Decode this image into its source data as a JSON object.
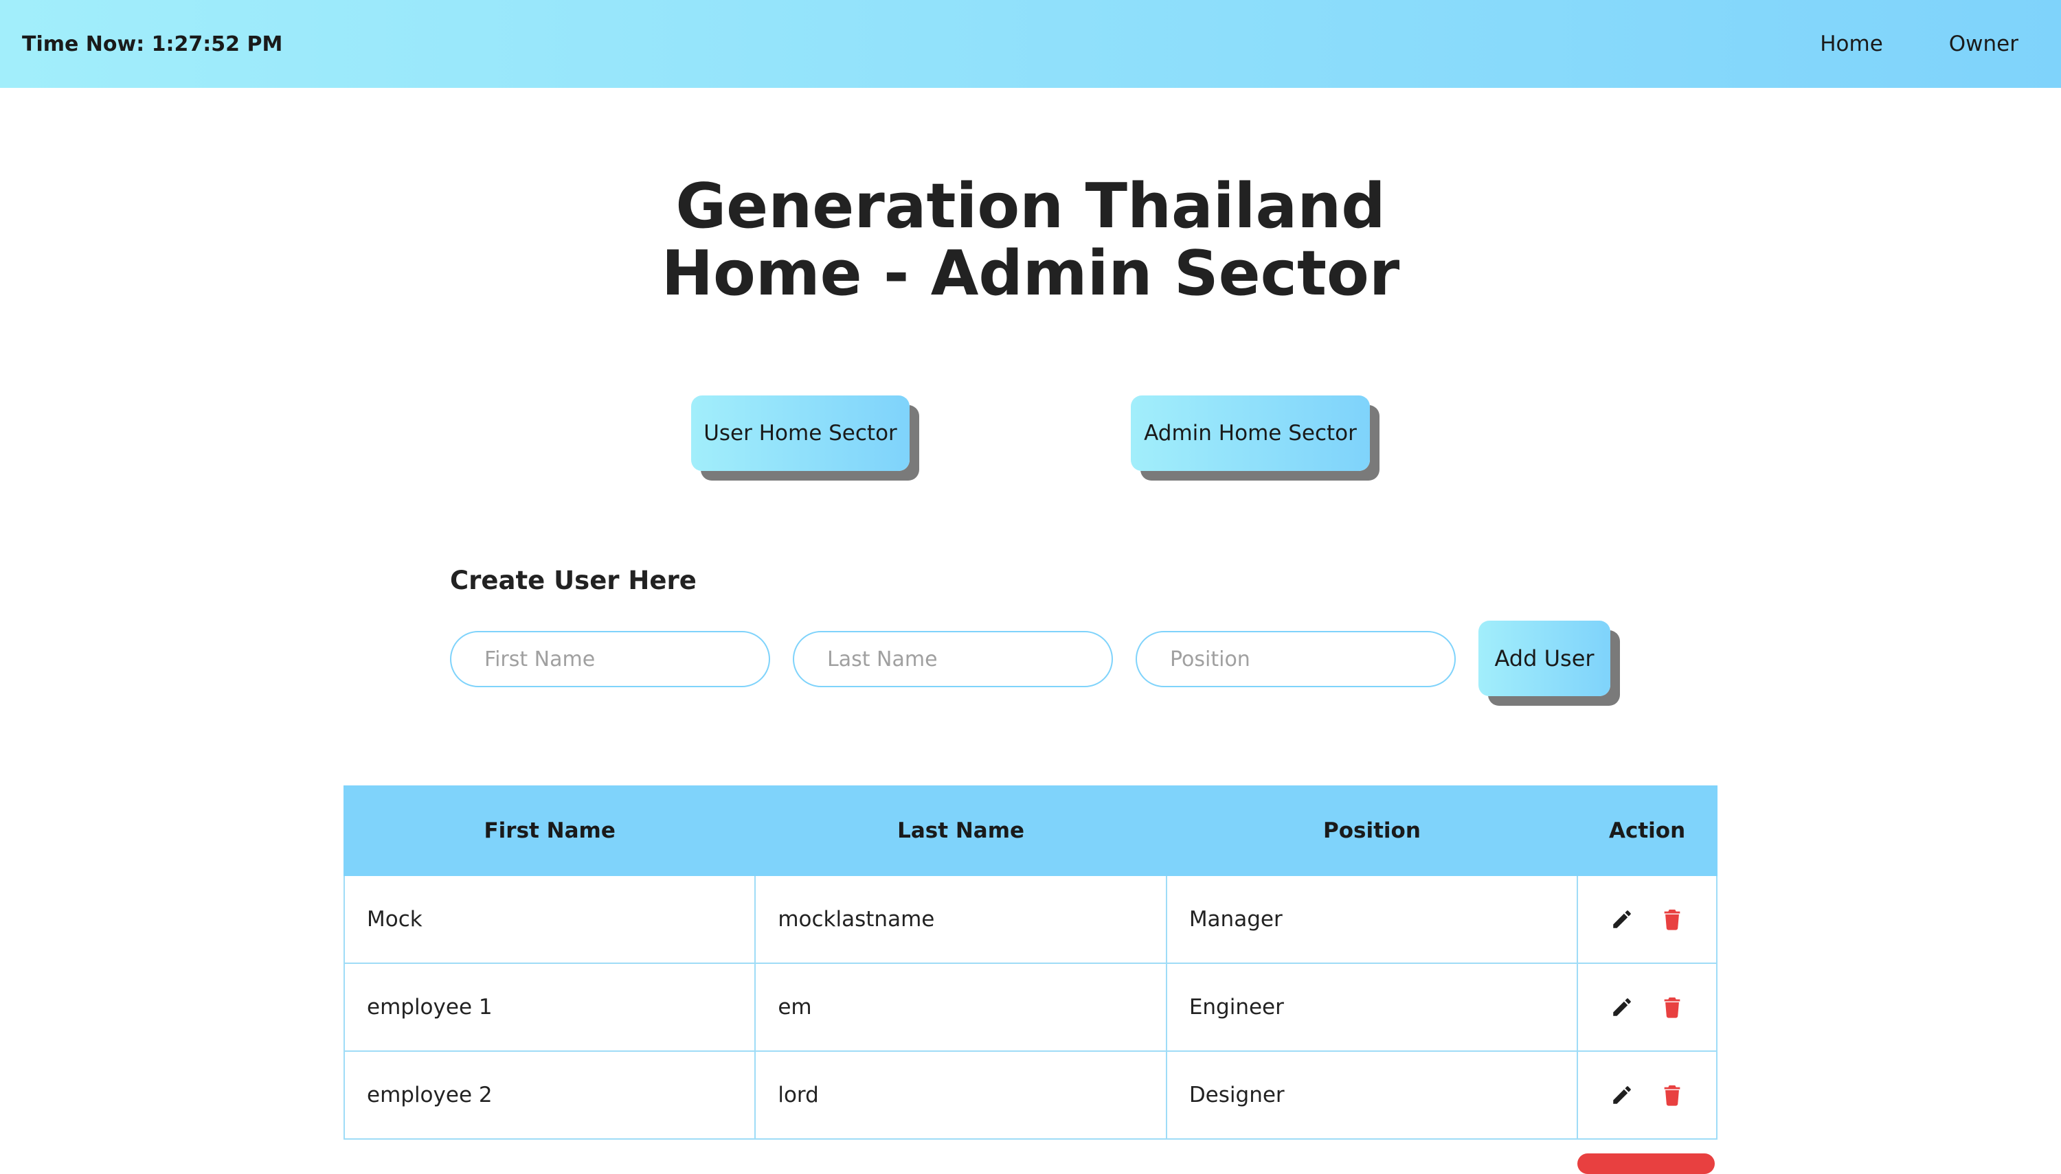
{
  "navbar": {
    "clock": "Time Now: 1:27:52 PM",
    "links": [
      "Home",
      "Owner"
    ]
  },
  "title": {
    "line1": "Generation Thailand",
    "line2": "Home - Admin Sector"
  },
  "sector_buttons": {
    "user": "User Home Sector",
    "admin": "Admin Home Sector"
  },
  "create_form": {
    "heading": "Create User Here",
    "first_name_placeholder": "First Name",
    "last_name_placeholder": "Last Name",
    "position_placeholder": "Position",
    "submit_label": "Add User"
  },
  "table": {
    "headers": [
      "First Name",
      "Last Name",
      "Position",
      "Action"
    ],
    "rows": [
      {
        "first": "Mock",
        "last": "mocklastname",
        "position": "Manager"
      },
      {
        "first": "employee 1",
        "last": "em",
        "position": "Engineer"
      },
      {
        "first": "employee 2",
        "last": "lord",
        "position": "Designer"
      }
    ],
    "action_icons": [
      "edit-icon",
      "trash-icon"
    ]
  },
  "colors": {
    "accent_start": "#a2eefb",
    "accent_end": "#7fd3fb",
    "delete": "#e84040",
    "shadow": "#7a7a7a"
  }
}
